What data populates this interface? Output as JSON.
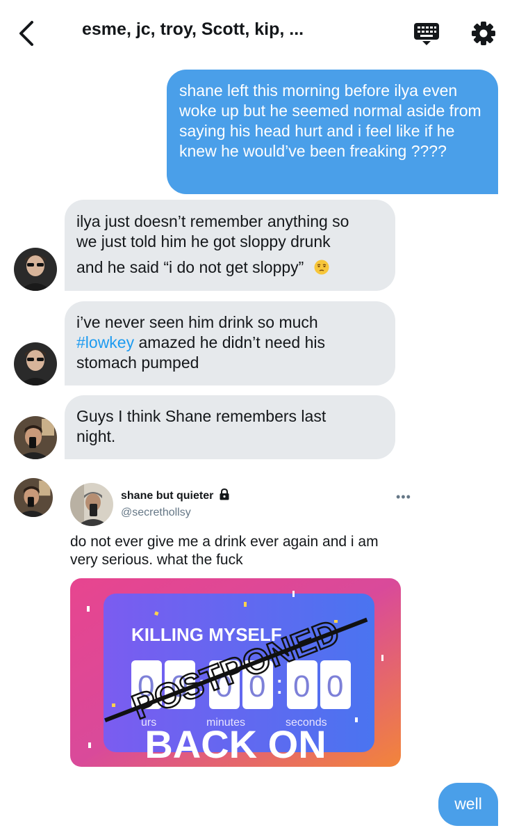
{
  "header": {
    "title": "esme, jc, troy, Scott, kip, ...",
    "back_icon": "chevron-left-icon",
    "keyboard_icon": "keyboard-icon",
    "settings_icon": "gear-icon"
  },
  "messages": [
    {
      "type": "sent",
      "text": "shane left this morning before ilya even woke up but he seemed normal aside from saying his head hurt and i feel like if he knew he would’ve been freaking ????"
    },
    {
      "type": "received",
      "line1": "ilya just doesn’t remember anything so",
      "line2": "we just told him he got sloppy drunk",
      "line3": "and he said “i do not get sloppy”",
      "emoji": "unamused-face"
    },
    {
      "type": "received",
      "line1": "i’ve never seen him drink so much",
      "hashtag": "#lowkey",
      "line2_rest": " amazed he didn’t need his",
      "line3": "stomach pumped"
    },
    {
      "type": "received",
      "line1": "Guys I think Shane remembers last",
      "line2": "night."
    },
    {
      "type": "shared_tweet"
    },
    {
      "type": "sent",
      "text": "well"
    }
  ],
  "tweet": {
    "name": "shane but quieter",
    "lock_icon": "lock-icon",
    "handle": "@secrethollsy",
    "more": "•••",
    "line1": "do not ever give me a drink ever again and i am",
    "line2": "very serious. what the fuck",
    "image": {
      "headline": "KILLING MYSELF",
      "digits": [
        "0",
        "0",
        "0",
        "0",
        "0",
        "0",
        "0"
      ],
      "colon": ":",
      "unit_hours": "urs",
      "unit_minutes": "minutes",
      "unit_seconds": "seconds",
      "struck": "POSTPONED",
      "banner": "BACK ON"
    }
  },
  "colors": {
    "sent_bubble": "#4a9fe9",
    "received_bubble": "#e6e9ec",
    "hashtag": "#1d9bf0"
  }
}
